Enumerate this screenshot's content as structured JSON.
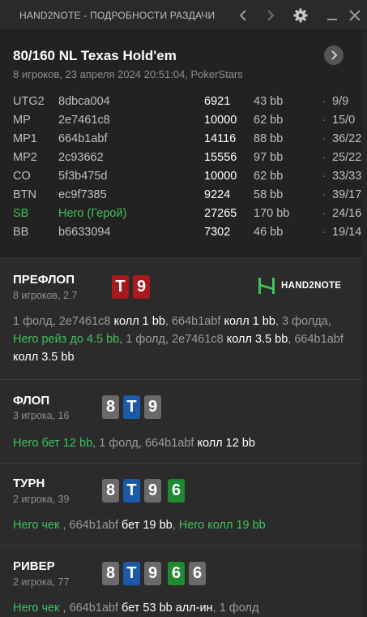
{
  "window": {
    "title": "HAND2NOTE - ПОДРОБНОСТИ РАЗДАЧИ",
    "icons": [
      "chevron-left-icon",
      "chevron-right-icon",
      "gear-icon",
      "minimize-icon",
      "close-icon"
    ]
  },
  "hand": {
    "title": "80/160 NL Texas Hold'em",
    "subtitle": "8 игроков, 23 апреля 2024 20:51:04, PokerStars"
  },
  "players": [
    {
      "pos": "UTG2",
      "name": "8dbca004",
      "stack": "6921",
      "bb": "43 bb",
      "dot": "·",
      "stats": "9/9"
    },
    {
      "pos": "MP",
      "name": "2e7461c8",
      "stack": "10000",
      "bb": "62 bb",
      "dot": "·",
      "stats": "15/0"
    },
    {
      "pos": "MP1",
      "name": "664b1abf",
      "stack": "14116",
      "bb": "88 bb",
      "dot": "·",
      "stats": "36/22"
    },
    {
      "pos": "MP2",
      "name": "2c93662",
      "stack": "15556",
      "bb": "97 bb",
      "dot": "·",
      "stats": "25/22"
    },
    {
      "pos": "CO",
      "name": "5f3b475d",
      "stack": "10000",
      "bb": "62 bb",
      "dot": "·",
      "stats": "33/33"
    },
    {
      "pos": "BTN",
      "name": "ec9f7385",
      "stack": "9224",
      "bb": "58 bb",
      "dot": "·",
      "stats": "39/17"
    },
    {
      "pos": "SB",
      "name": "Hero (Герой)",
      "stack": "27265",
      "bb": "170 bb",
      "dot": "·",
      "stats": "24/16"
    },
    {
      "pos": "BB",
      "name": "b6633094",
      "stack": "7302",
      "bb": "46 bb",
      "dot": "·",
      "stats": "19/14"
    }
  ],
  "colors": {
    "hero": "#3ec25a",
    "card_red": "#a8191b",
    "card_gray": "#6a6a6a",
    "card_blue": "#1a5aa8",
    "card_green": "#1f8a33"
  },
  "logo": {
    "text": "HAND2NOTE"
  },
  "preflop": {
    "name": "ПРЕФЛОП",
    "sub": "8 игроков, 2.7",
    "cards": [
      "T",
      "9"
    ],
    "action": [
      "1 фолд, 2e7461c8 ",
      "колл 1 bb",
      ", 664b1abf ",
      "колл 1 bb",
      ", 3 фолда, ",
      "Hero рейз до 4.5 bb",
      ", 1 фолд, 2e7461c8 ",
      "колл 3.5 bb",
      ", 664b1abf ",
      "колл 3.5 bb"
    ]
  },
  "flop": {
    "name": "ФЛОП",
    "sub": "3 игрока, 16",
    "cards": [
      "8",
      "T",
      "9"
    ],
    "action": [
      "Hero бет 12 bb",
      ", 1 фолд, 664b1abf ",
      "колл 12 bb"
    ]
  },
  "turn": {
    "name": "ТУРН",
    "sub": "2 игрока, 39",
    "cards": [
      "8",
      "T",
      "9",
      "6"
    ],
    "action": [
      "Hero чек ",
      ", 664b1abf ",
      "бет 19 bb",
      ", ",
      "Hero колл 19 bb"
    ]
  },
  "river": {
    "name": "РИВЕР",
    "sub": "2 игрока, 77",
    "cards": [
      "8",
      "T",
      "9",
      "6",
      "6"
    ],
    "action": [
      "Hero чек ",
      ", 664b1abf ",
      "бет 53 bb алл-ин",
      ", 1 фолд"
    ]
  }
}
